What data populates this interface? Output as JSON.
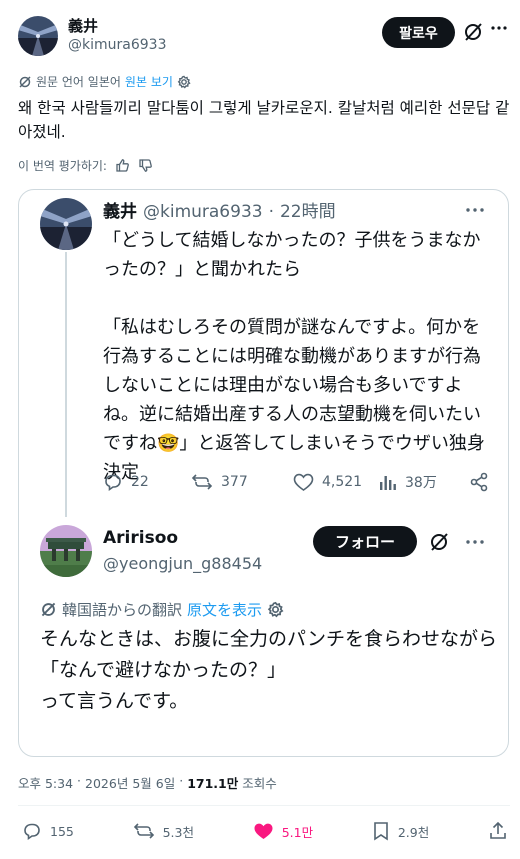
{
  "post": {
    "author_name": "義井",
    "author_handle": "@kimura6933",
    "follow_label": "팔로우",
    "translation_note": "원문 언어 일본어",
    "view_original": "원본 보기",
    "body": "왜 한국 사람들끼리 말다툼이 그렇게 날카로운지. 칼날처럼 예리한 선문답 같아졌네.",
    "rate_translation": "이 번역 평가하기:",
    "time": "오후 5:34",
    "date": "2026년 5월 6일",
    "views_count": "171.1만",
    "views_label": "조회수",
    "dot": "·"
  },
  "quoted": {
    "author_name": "義井",
    "author_handle": "@kimura6933",
    "time": "22時間",
    "dot": "·",
    "text": "「どうして結婚しなかったの？子供をうまなかったの？」と聞かれたら\n\n「私はむしろその質問が謎なんですよ。何かを行為することには明確な動機がありますが行為しないことには理由がない場合も多いですよね。逆に結婚出産する人の志望動機を伺いたいですね🤓」と返答してしまいそうでウザい独身決定",
    "replies": "22",
    "reposts": "377",
    "likes": "4,521",
    "views": "38万"
  },
  "reply": {
    "author_name": "Aririsoo",
    "author_handle": "@yeongjun_g88454",
    "follow_label": "フォロー",
    "translation_note": "韓国語からの翻訳",
    "view_original": "原文を表示",
    "text": "そんなときは、お腹に全力のパンチを食らわせながら\n「なんで避けなかったの？」\nって言うんです。"
  },
  "actions": {
    "replies": "155",
    "reposts": "5.3천",
    "likes": "5.1만",
    "bookmarks": "2.9천"
  },
  "colors": {
    "text": "#0f1419",
    "secondary": "#536471",
    "link": "#1d9bf0",
    "like": "#f91880",
    "border": "#cfd9de"
  }
}
